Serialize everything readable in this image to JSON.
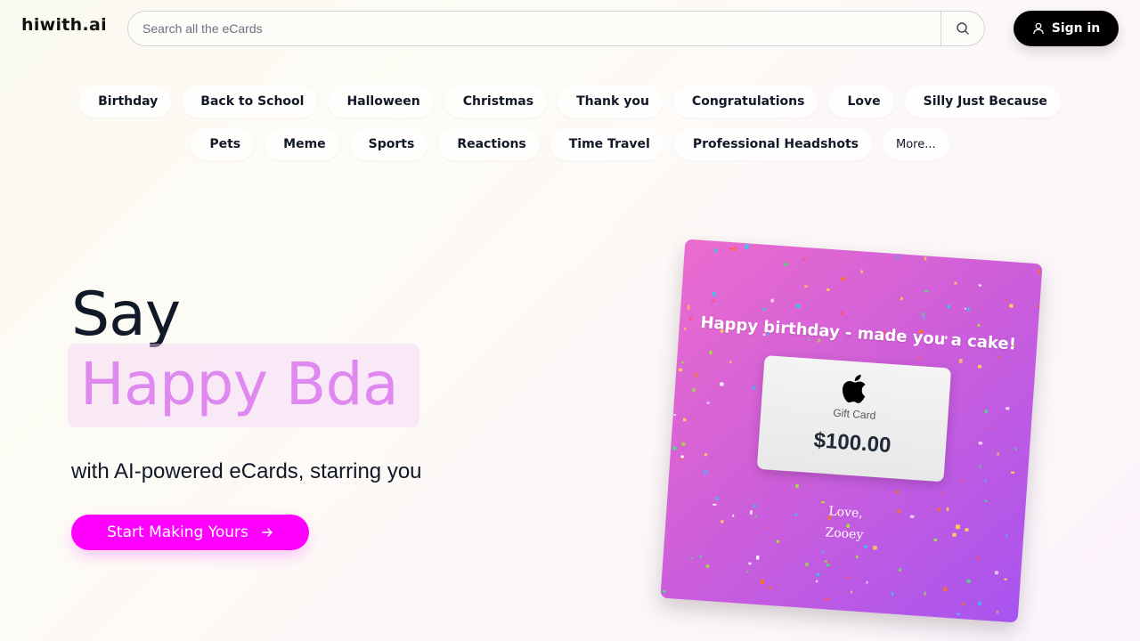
{
  "header": {
    "logo": "hiwith.ai",
    "search_placeholder": "Search all the eCards",
    "signin_label": "Sign in"
  },
  "categories_row1": [
    {
      "icon": "",
      "label": "Birthday"
    },
    {
      "icon": "",
      "label": "Back to School"
    },
    {
      "icon": "",
      "label": "Halloween"
    },
    {
      "icon": "",
      "label": "Christmas"
    },
    {
      "icon": "",
      "label": "Thank you"
    },
    {
      "icon": "",
      "label": "Congratulations"
    },
    {
      "icon": "",
      "label": "Love"
    },
    {
      "icon": "",
      "label": "Silly Just Because"
    }
  ],
  "categories_row2": [
    {
      "icon": "",
      "label": "Pets"
    },
    {
      "icon": "",
      "label": "Meme"
    },
    {
      "icon": "",
      "label": "Sports"
    },
    {
      "icon": "",
      "label": "Reactions"
    },
    {
      "icon": "",
      "label": "Time Travel"
    },
    {
      "icon": "",
      "label": "Professional Headshots"
    }
  ],
  "more_label": "More...",
  "hero": {
    "say": "Say",
    "animated_text": "Happy Bda",
    "tagline": "with AI-powered eCards, starring you",
    "cta_label": "Start Making Yours"
  },
  "card": {
    "title": "Happy birthday - made you a cake!",
    "gift_label": "Gift Card",
    "gift_amount": "$100.00",
    "signoff_line1": "Love,",
    "signoff_line2": "Zooey"
  },
  "colors": {
    "accent": "#ff00ff",
    "highlight_text": "#de88f0",
    "card_gradient_start": "#ea6ccf",
    "card_gradient_end": "#a854f0"
  }
}
